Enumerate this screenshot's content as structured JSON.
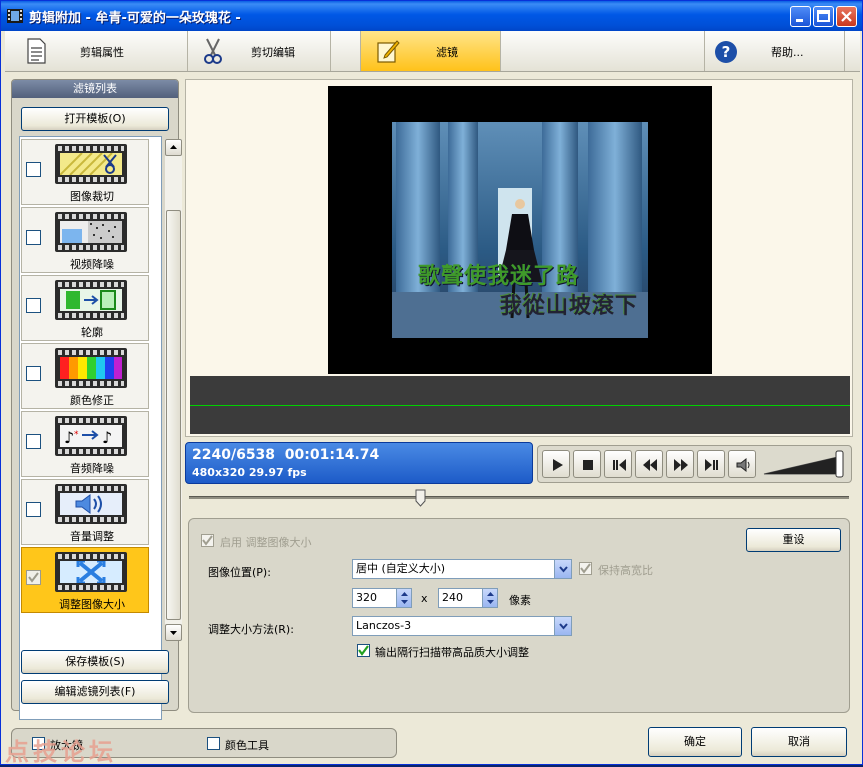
{
  "window": {
    "title": "剪辑附加 - 牟青-可爱的一朵玫瑰花 -"
  },
  "toolbar": {
    "clip_properties": "剪辑属性",
    "cut_edit": "剪切编辑",
    "filters": "滤镜",
    "help": "帮助..."
  },
  "filter_panel": {
    "header": "滤镜列表",
    "open_template": "打开模板(O)",
    "save_template": "保存模板(S)",
    "edit_filter_list": "编辑滤镜列表(F)",
    "items": [
      {
        "label": "图像裁切",
        "checked": false
      },
      {
        "label": "视频降噪",
        "checked": false
      },
      {
        "label": "轮廓",
        "checked": false
      },
      {
        "label": "颜色修正",
        "checked": false
      },
      {
        "label": "音频降噪",
        "checked": false
      },
      {
        "label": "音量调整",
        "checked": false
      },
      {
        "label": "调整图像大小",
        "checked": true
      }
    ]
  },
  "preview": {
    "subtitle_line1": "歌聲使我迷了路",
    "subtitle_line2": "我從山坡滾下"
  },
  "status": {
    "frame": "2240/6538",
    "timecode": "00:01:14.74",
    "format": "480x320 29.97 fps"
  },
  "seek": {
    "position": 0.35
  },
  "volume": {
    "level": 0.95
  },
  "settings": {
    "enable_resize": "启用 调整图像大小",
    "reset": "重设",
    "image_position_label": "图像位置(P):",
    "image_position_value": "居中 (自定义大小)",
    "keep_aspect": "保持高宽比",
    "width": "320",
    "x": "x",
    "height": "240",
    "pixels": "像素",
    "resize_method_label": "调整大小方法(R):",
    "resize_method_value": "Lanczos-3",
    "interlaced_option": "输出隔行扫描带高品质大小调整"
  },
  "bottom": {
    "magnifier": "放大镜",
    "color_tool": "颜色工具",
    "ok": "确定",
    "cancel": "取消",
    "watermark": "点技论坛"
  }
}
